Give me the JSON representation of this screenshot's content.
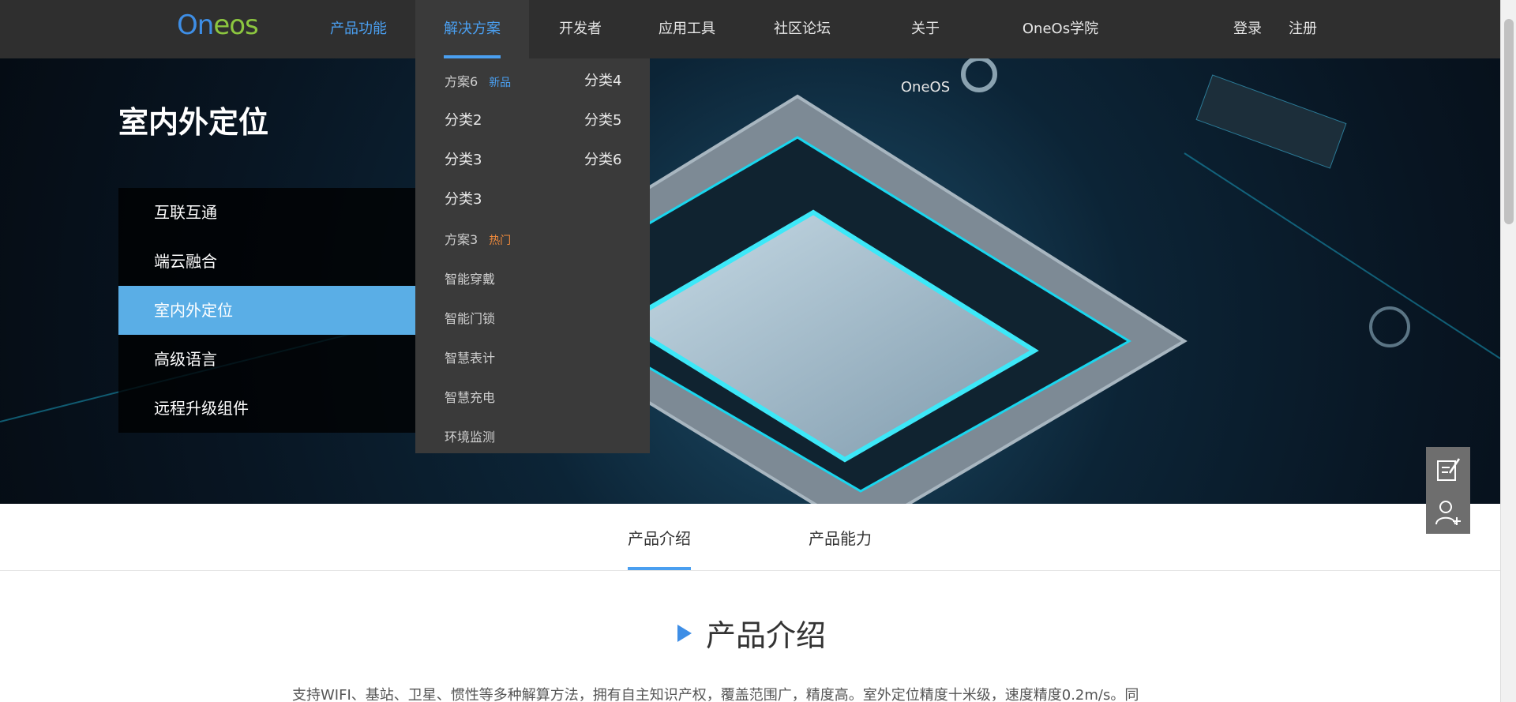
{
  "logo": {
    "part1": "On",
    "part2": "eos"
  },
  "nav": {
    "items": [
      {
        "label": "产品功能"
      },
      {
        "label": "解决方案"
      },
      {
        "label": "开发者"
      },
      {
        "label": "应用工具"
      },
      {
        "label": "社区论坛"
      },
      {
        "label": "关于OneOS"
      },
      {
        "label": "OneOs学院"
      }
    ],
    "login": "登录",
    "register": "注册"
  },
  "dropdown": {
    "items": [
      {
        "label": "方案6",
        "tag": "新品"
      },
      {
        "label": "分类4"
      },
      {
        "label": "分类2"
      },
      {
        "label": "分类5"
      },
      {
        "label": "分类3"
      },
      {
        "label": "分类6"
      },
      {
        "label": "分类3"
      },
      {
        "label": "方案3",
        "tag": "热门"
      },
      {
        "label": "智能穿戴"
      },
      {
        "label": "智能门锁"
      },
      {
        "label": "智慧表计"
      },
      {
        "label": "智慧充电"
      },
      {
        "label": "环境监测"
      }
    ]
  },
  "hero": {
    "title": "室内外定位",
    "menu": [
      {
        "label": "互联互通"
      },
      {
        "label": "端云融合"
      },
      {
        "label": "室内外定位"
      },
      {
        "label": "高级语言"
      },
      {
        "label": "远程升级组件"
      }
    ]
  },
  "tabs": [
    {
      "label": "产品介绍"
    },
    {
      "label": "产品能力"
    }
  ],
  "section": {
    "title": "产品介绍",
    "text": "支持WIFI、基站、卫星、惯性等多种解算方法，拥有自主知识产权，覆盖范围广，精度高。室外定位精度十米级，速度精度0.2m/s。同"
  },
  "floating": {
    "icons": [
      "feedback-icon",
      "add-user-icon"
    ]
  },
  "colors": {
    "accent": "#4a9ff0",
    "nav_bg": "#2f2f2f",
    "menu_active": "#5aaee6",
    "hot": "#f08a3c"
  }
}
